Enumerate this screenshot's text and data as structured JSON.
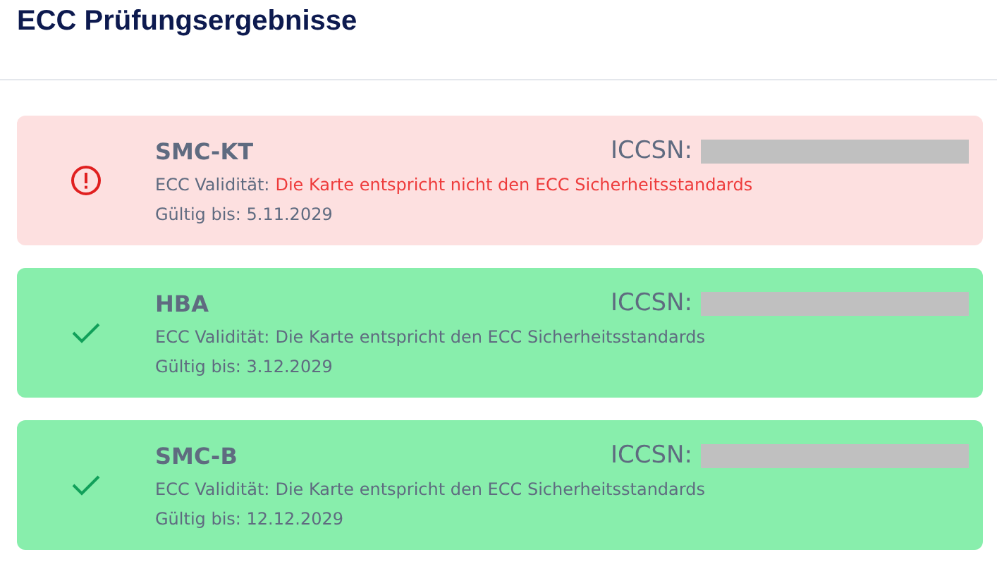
{
  "title": "ECC Prüfungsergebnisse",
  "cards": [
    {
      "name": "SMC-KT",
      "valid": false,
      "iccsn_label": "ICCSN:",
      "validity_label": "ECC Validität:",
      "validity_text": "Die Karte entspricht nicht den ECC Sicherheitsstandards",
      "expiry": "Gültig bis: 5.11.2029"
    },
    {
      "name": "HBA",
      "valid": true,
      "iccsn_label": "ICCSN:",
      "validity_label": "ECC Validität:",
      "validity_text": "Die Karte entspricht den ECC Sicherheitsstandards",
      "expiry": "Gültig bis: 3.12.2029"
    },
    {
      "name": "SMC-B",
      "valid": true,
      "iccsn_label": "ICCSN:",
      "validity_label": "ECC Validität:",
      "validity_text": "Die Karte entspricht den ECC Sicherheitsstandards",
      "expiry": "Gültig bis: 12.12.2029"
    }
  ]
}
